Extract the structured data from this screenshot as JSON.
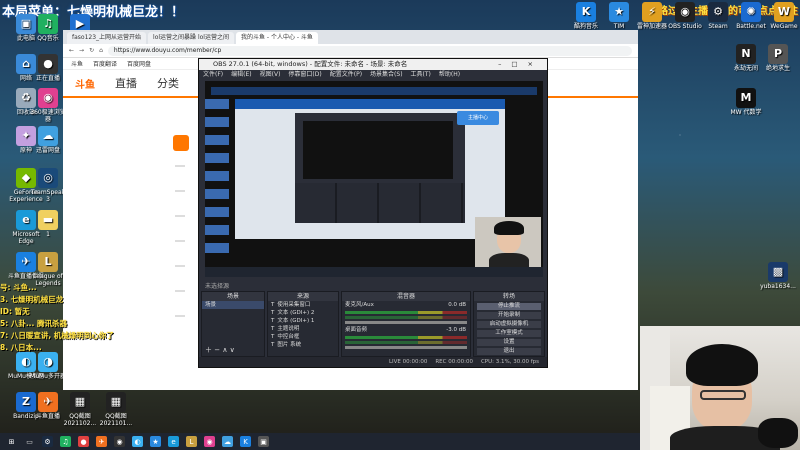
{
  "overlay": {
    "title": "本局菜单：七燥明机械巨龙！！",
    "right_banner": "班路过的主播喜欢的可以点点关注"
  },
  "desktop_left": [
    {
      "label": "此电脑",
      "icon": "computer-icon",
      "color": "#3a8ad8",
      "glyph": "▣"
    },
    {
      "label": "QQ音乐",
      "icon": "qq-music-icon",
      "color": "#20b060",
      "glyph": "♫"
    },
    {
      "label": "迅雷影音",
      "icon": "xunlei-icon",
      "color": "#2070d0",
      "glyph": "▶"
    },
    {
      "label": "网络",
      "icon": "network-icon",
      "color": "#3a8ad8",
      "glyph": "⌂"
    },
    {
      "label": "正在直播",
      "icon": "live-icon",
      "color": "#333",
      "glyph": "●"
    },
    {
      "label": "回收站",
      "icon": "recycle-bin-icon",
      "color": "#9ab",
      "glyph": "♻"
    },
    {
      "label": "360极速浏览器",
      "icon": "browser-360-icon",
      "color": "#e04090",
      "glyph": "◉"
    },
    {
      "label": "原神",
      "icon": "genshin-icon",
      "color": "#c4a0e0",
      "glyph": "✦"
    },
    {
      "label": "迅雷网盘",
      "icon": "cloud-icon",
      "color": "#40a0e0",
      "glyph": "☁"
    },
    {
      "label": "GeForce Experience",
      "icon": "nvidia-icon",
      "color": "#76b900",
      "glyph": "◆"
    },
    {
      "label": "TeamSpeak 3",
      "icon": "teamspeak-icon",
      "color": "#1a4a7a",
      "glyph": "◎"
    },
    {
      "label": "Microsoft Edge",
      "icon": "edge-icon",
      "color": "#1a9ad8",
      "glyph": "e"
    },
    {
      "label": "1",
      "icon": "folder-icon",
      "color": "#f0d060",
      "glyph": "▬"
    },
    {
      "label": "斗鱼直播伴侣",
      "icon": "douyu-icon",
      "color": "#1a80e0",
      "glyph": "✈"
    },
    {
      "label": "League of Legends",
      "icon": "lol-icon",
      "color": "#c8a040",
      "glyph": "L"
    },
    {
      "label": "MuMu模拟器",
      "icon": "mumu-icon",
      "color": "#3ab0f0",
      "glyph": "◐"
    },
    {
      "label": "MuMu多开器",
      "icon": "mumu-multi-icon",
      "color": "#3ab0f0",
      "glyph": "◑"
    },
    {
      "label": "Bandizip",
      "icon": "bandizip-icon",
      "color": "#1a6ad0",
      "glyph": "Z"
    },
    {
      "label": "斗鱼直播",
      "icon": "douyu-live-icon",
      "color": "#f07020",
      "glyph": "✈"
    },
    {
      "label": "QQ截图 2021102...",
      "icon": "screenshot-icon",
      "color": "#222",
      "glyph": "▦"
    },
    {
      "label": "QQ截图 2021101...",
      "icon": "screenshot-icon",
      "color": "#222",
      "glyph": "▦"
    }
  ],
  "desktop_top_right": [
    {
      "label": "酷狗音乐",
      "icon": "kugou-icon",
      "color": "#1a80e0",
      "glyph": "K"
    },
    {
      "label": "TIM",
      "icon": "tim-icon",
      "color": "#2a8ae0",
      "glyph": "★"
    },
    {
      "label": "雷神加速器",
      "icon": "leishen-icon",
      "color": "#e0a020",
      "glyph": "⚡"
    },
    {
      "label": "OBS Studio",
      "icon": "obs-icon",
      "color": "#222",
      "glyph": "◉"
    },
    {
      "label": "Steam",
      "icon": "steam-icon",
      "color": "#1a2a40",
      "glyph": "⚙"
    },
    {
      "label": "Battle.net",
      "icon": "battlenet-icon",
      "color": "#1a6ad0",
      "glyph": "✺"
    },
    {
      "label": "WeGame",
      "icon": "wegame-icon",
      "color": "#e0a020",
      "glyph": "W"
    }
  ],
  "desktop_right": [
    {
      "label": "永劫无间",
      "icon": "naraka-icon",
      "color": "#222",
      "glyph": "N"
    },
    {
      "label": "绝地求生",
      "icon": "pubg-icon",
      "color": "#555",
      "glyph": "P"
    },
    {
      "label": "MW 代数学",
      "icon": "mw-icon",
      "color": "#111",
      "glyph": "M"
    },
    {
      "label": "yuba1634...",
      "icon": "image-file-icon",
      "color": "#1a3a6a",
      "glyph": "▩"
    }
  ],
  "chat": [
    {
      "text": "号: 斗鱼...",
      "color": "#ffe040"
    },
    {
      "text": "3. 七燥明机械巨龙",
      "color": "#ffe040"
    },
    {
      "text": "ID: 暂无",
      "color": "#ffe040"
    },
    {
      "text": "5: 八卦... 腾讯杀器",
      "color": "#ffe040"
    },
    {
      "text": "7: 八日暖宣讲, 机械燥明到心你了",
      "color": "#ffe040"
    },
    {
      "text": "8. 八日本...",
      "color": "#ffe040"
    }
  ],
  "browser": {
    "tabs": [
      "faso123_上网从运营开始",
      "lol运营之间暴躁 lol运营之间",
      "我的斗鱼 - 个人中心 - 斗鱼"
    ],
    "url": "https://www.douyu.com/member/cp",
    "bookmarks": [
      "斗鱼",
      "百度翻译",
      "百度网盘"
    ],
    "nav": [
      "直播",
      "分类"
    ],
    "site_logo": "斗鱼"
  },
  "obs": {
    "title": "OBS 27.0.1 (64-bit, windows) - 配置文件: 未命名 - 场景: 未命名",
    "menu": [
      "文件(F)",
      "编辑(E)",
      "视图(V)",
      "停靠窗口(D)",
      "配置文件(P)",
      "场景集合(S)",
      "工具(T)",
      "帮助(H)"
    ],
    "no_source": "未选择源",
    "docks": {
      "scenes": "场景",
      "sources": "来源",
      "mixer": "混音器",
      "transitions": "转场",
      "controls": "控制"
    },
    "scene_items": [
      "场景"
    ],
    "source_items": [
      "使用采集窗口",
      "文本 (GDI+) 2",
      "文本 (GDI+) 1",
      "主题说明",
      "中控台框",
      "图片 系统"
    ],
    "mixer_items": [
      {
        "name": "麦克风/Aux",
        "db": "0.0 dB"
      },
      {
        "name": "桌面音频",
        "db": "-3.0 dB"
      }
    ],
    "controls": [
      "停止推流",
      "开始录制",
      "启动虚拟摄像机",
      "工作室模式",
      "设置",
      "退出"
    ],
    "status": [
      "LIVE 00:00:00",
      "REC 00:00:00",
      "CPU: 3.1%, 30.00 fps"
    ]
  }
}
